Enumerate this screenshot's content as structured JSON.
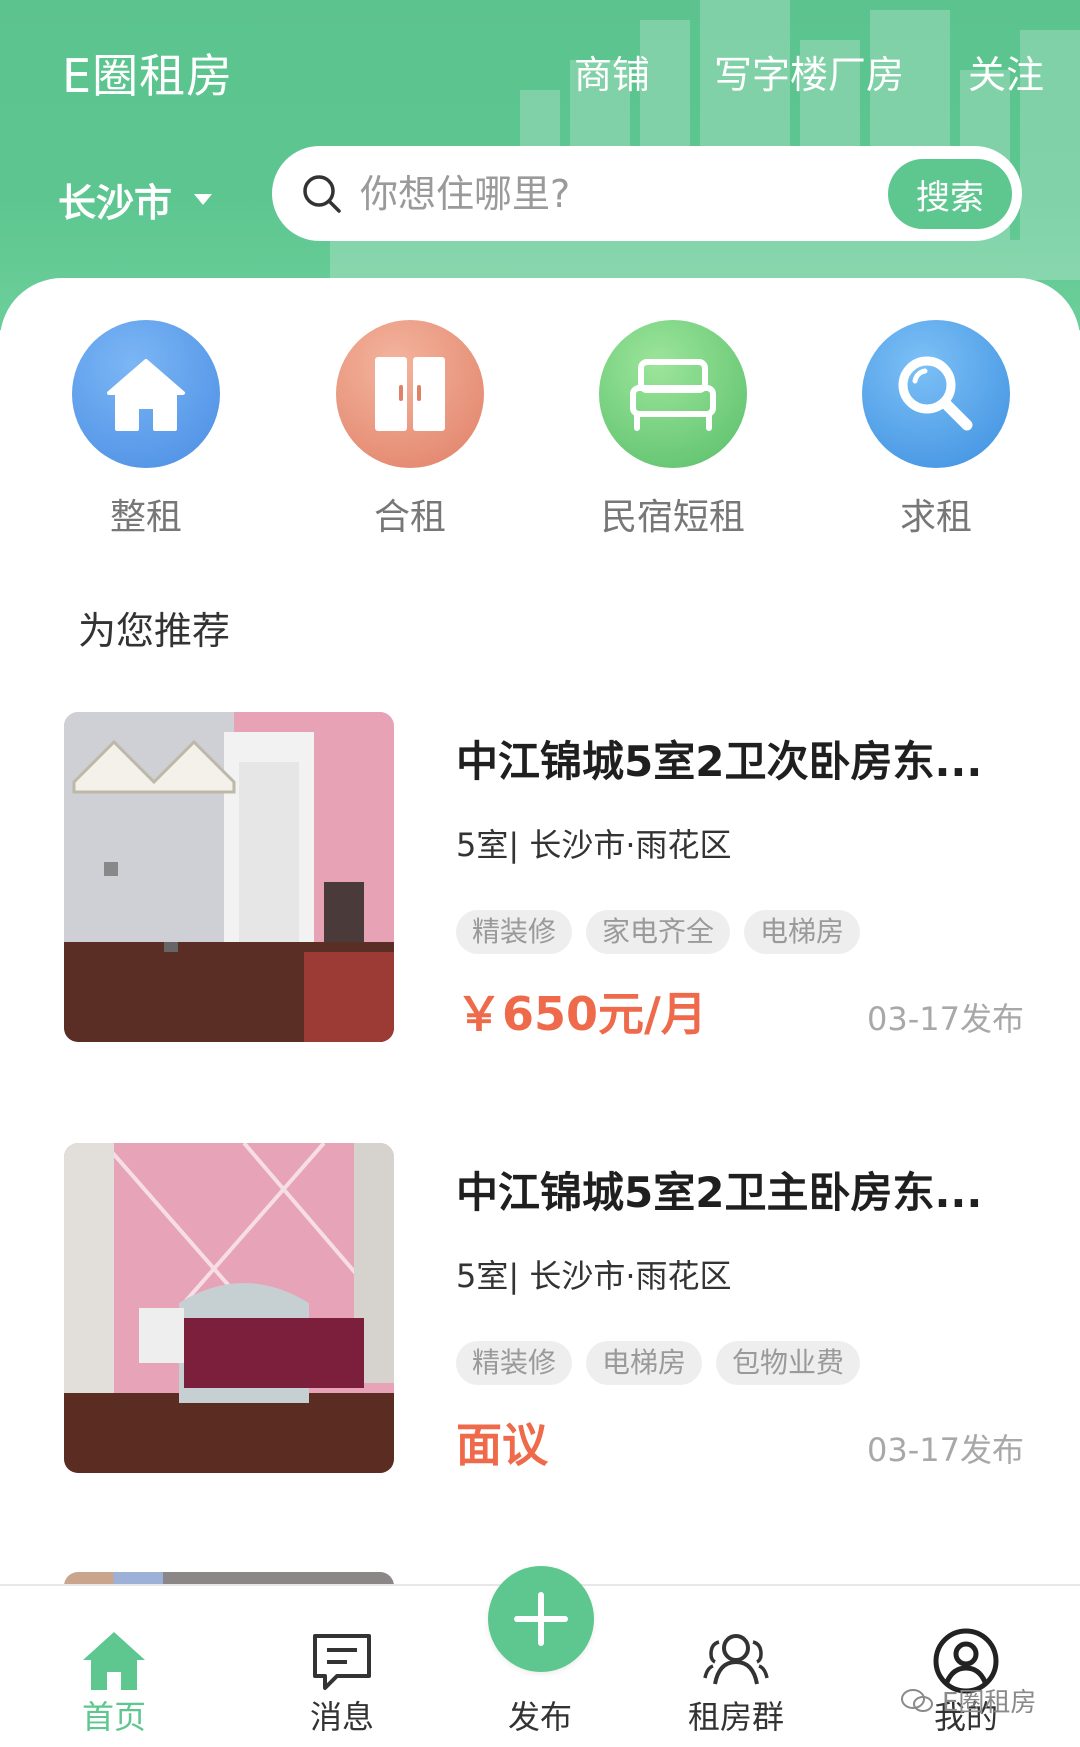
{
  "header": {
    "app_title": "E圈租房",
    "nav": [
      "商铺",
      "写字楼厂房",
      "关注"
    ],
    "city": "长沙市",
    "search_placeholder": "你想住哪里?",
    "search_button": "搜索"
  },
  "categories": [
    {
      "label": "整租",
      "icon": "house-icon",
      "color": "#4a8de3"
    },
    {
      "label": "合租",
      "icon": "door-icon",
      "color": "#e08066"
    },
    {
      "label": "民宿短租",
      "icon": "bed-icon",
      "color": "#58be6a"
    },
    {
      "label": "求租",
      "icon": "magnifier-icon",
      "color": "#3d8fe0"
    }
  ],
  "recommend_title": "为您推荐",
  "listings": [
    {
      "title": "中江锦城5室2卫次卧房东...",
      "subtitle": "5室| 长沙市·雨花区",
      "tags": [
        "精装修",
        "家电齐全",
        "电梯房"
      ],
      "price": "￥650元/月",
      "date": "03-17发布"
    },
    {
      "title": "中江锦城5室2卫主卧房东...",
      "subtitle": "5室| 长沙市·雨花区",
      "tags": [
        "精装修",
        "电梯房",
        "包物业费"
      ],
      "price": "面议",
      "date": "03-17发布"
    }
  ],
  "tabbar": {
    "items": [
      {
        "label": "首页",
        "icon": "home-icon",
        "active": true
      },
      {
        "label": "消息",
        "icon": "message-icon",
        "active": false
      },
      {
        "label": "发布",
        "icon": "plus-icon",
        "active": false
      },
      {
        "label": "租房群",
        "icon": "group-icon",
        "active": false
      },
      {
        "label": "我的",
        "icon": "user-icon",
        "active": false
      }
    ]
  },
  "watermark": "E圈租房",
  "colors": {
    "accent": "#5ec790",
    "price": "#ee6a4b"
  }
}
